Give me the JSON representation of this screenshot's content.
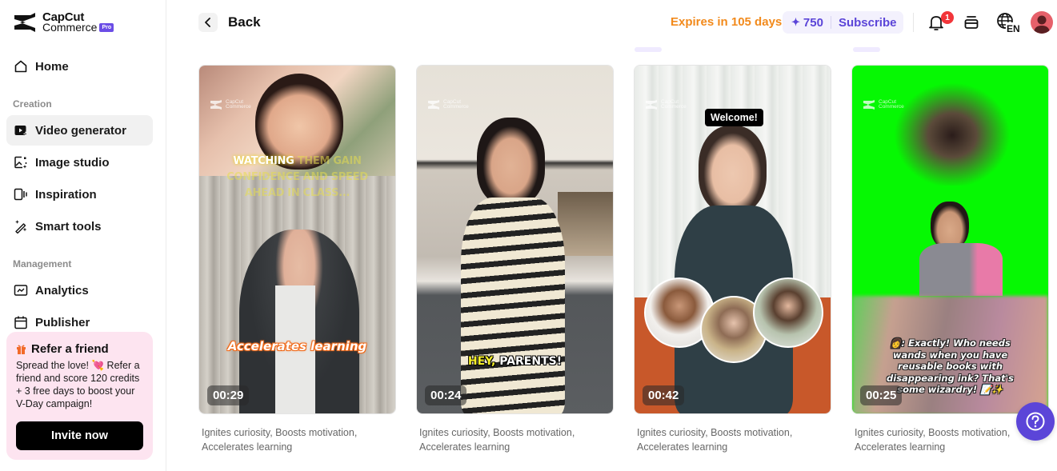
{
  "brand": {
    "name_line1": "CapCut",
    "name_line2": "Commerce",
    "badge": "Pro"
  },
  "sidebar": {
    "home": "Home",
    "sections": [
      {
        "label": "Creation",
        "items": [
          {
            "label": "Video generator",
            "icon": "video-sparkle-icon",
            "active": true
          },
          {
            "label": "Image studio",
            "icon": "image-sparkle-icon",
            "active": false
          },
          {
            "label": "Inspiration",
            "icon": "inspiration-icon",
            "active": false
          },
          {
            "label": "Smart tools",
            "icon": "magic-wand-icon",
            "active": false
          }
        ]
      },
      {
        "label": "Management",
        "items": [
          {
            "label": "Analytics",
            "icon": "analytics-icon",
            "active": false
          },
          {
            "label": "Publisher",
            "icon": "calendar-icon",
            "active": false
          }
        ]
      }
    ],
    "refer": {
      "title": "Refer a friend",
      "body": "Spread the love! 💘 Refer a friend and score 120 credits + 3 free days to boost your V-Day campaign!",
      "button": "Invite now"
    }
  },
  "header": {
    "back_label": "Back",
    "expires": "Expires in 105 days",
    "credits": "750",
    "subscribe": "Subscribe",
    "notification_count": "1",
    "language": "EN"
  },
  "colors": {
    "accent": "#5b45d8",
    "expires": "#f28a1c",
    "badge_red": "#f2353a"
  },
  "videos": [
    {
      "duration": "00:29",
      "caption": "Ignites curiosity, Boosts motivation, Accelerates learning",
      "overlay_top_highlight": "WATCHING",
      "overlay_top_rest": " THEM GAIN CONFIDENCE AND SPEED AHEAD IN CLASS...",
      "overlay_bottom": "Accelerates learning"
    },
    {
      "duration": "00:24",
      "caption": "Ignites curiosity, Boosts motivation, Accelerates learning",
      "overlay_highlight": "HEY,",
      "overlay_rest": " PARENTS!"
    },
    {
      "duration": "00:42",
      "caption": "Ignites curiosity, Boosts motivation, Accelerates learning",
      "overlay_label": "Welcome!"
    },
    {
      "duration": "00:25",
      "caption": "Ignites curiosity, Boosts motivation, Accelerates learning",
      "overlay_text": "👩: Exactly! Who needs wands when you have reusable books with disappearing ink? That's some wizardry! 📝✨"
    }
  ],
  "watermark": {
    "line1": "CapCut",
    "line2": "Commerce"
  }
}
